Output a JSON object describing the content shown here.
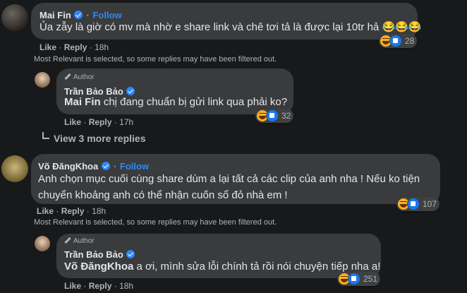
{
  "comments": [
    {
      "author": "Mai Fin",
      "follow": "Follow",
      "text": "Ủa zẫy là giờ có mv mà nhờ e share link và chê tơi tả là được lại 10tr hả",
      "text_emoji": "😂😂😂",
      "actions": {
        "like": "Like",
        "reply": "Reply",
        "time": "18h"
      },
      "reactions": 28
    },
    {
      "author_badge": "Author",
      "author": "Trần Bảo Bảo",
      "mention": "Mai Fin",
      "text": " chị đang chuẩn bị gửi link qua phải ko?",
      "actions": {
        "like": "Like",
        "reply": "Reply",
        "time": "17h"
      },
      "reactions": 32
    },
    {
      "author": "Võ ĐăngKhoa",
      "follow": "Follow",
      "text_line1": "Anh chọn mục cuối cùng share dùm a lại tất cả các clip của anh nha ! Nếu ko tiện",
      "text_line2": "chuyển khoảng anh có thể nhận cuốn sổ đỏ nhà em !",
      "actions": {
        "like": "Like",
        "reply": "Reply",
        "time": "18h"
      },
      "reactions": 107
    },
    {
      "author_badge": "Author",
      "author": "Trần Bảo Bảo",
      "mention": "Võ ĐăngKhoa",
      "text": " a ơi, mình sửa lỗi chính tả rồi nói chuyện tiếp nha a!",
      "actions": {
        "like": "Like",
        "reply": "Reply",
        "time": "18h"
      },
      "reactions": 251
    }
  ],
  "filter_notice": "Most Relevant is selected, so some replies may have been filtered out.",
  "view_more": "View 3 more replies",
  "colors": {
    "background": "#18191a",
    "bubble": "#3a3b3c",
    "link": "#2d88ff",
    "muted": "#b0b3b8"
  }
}
